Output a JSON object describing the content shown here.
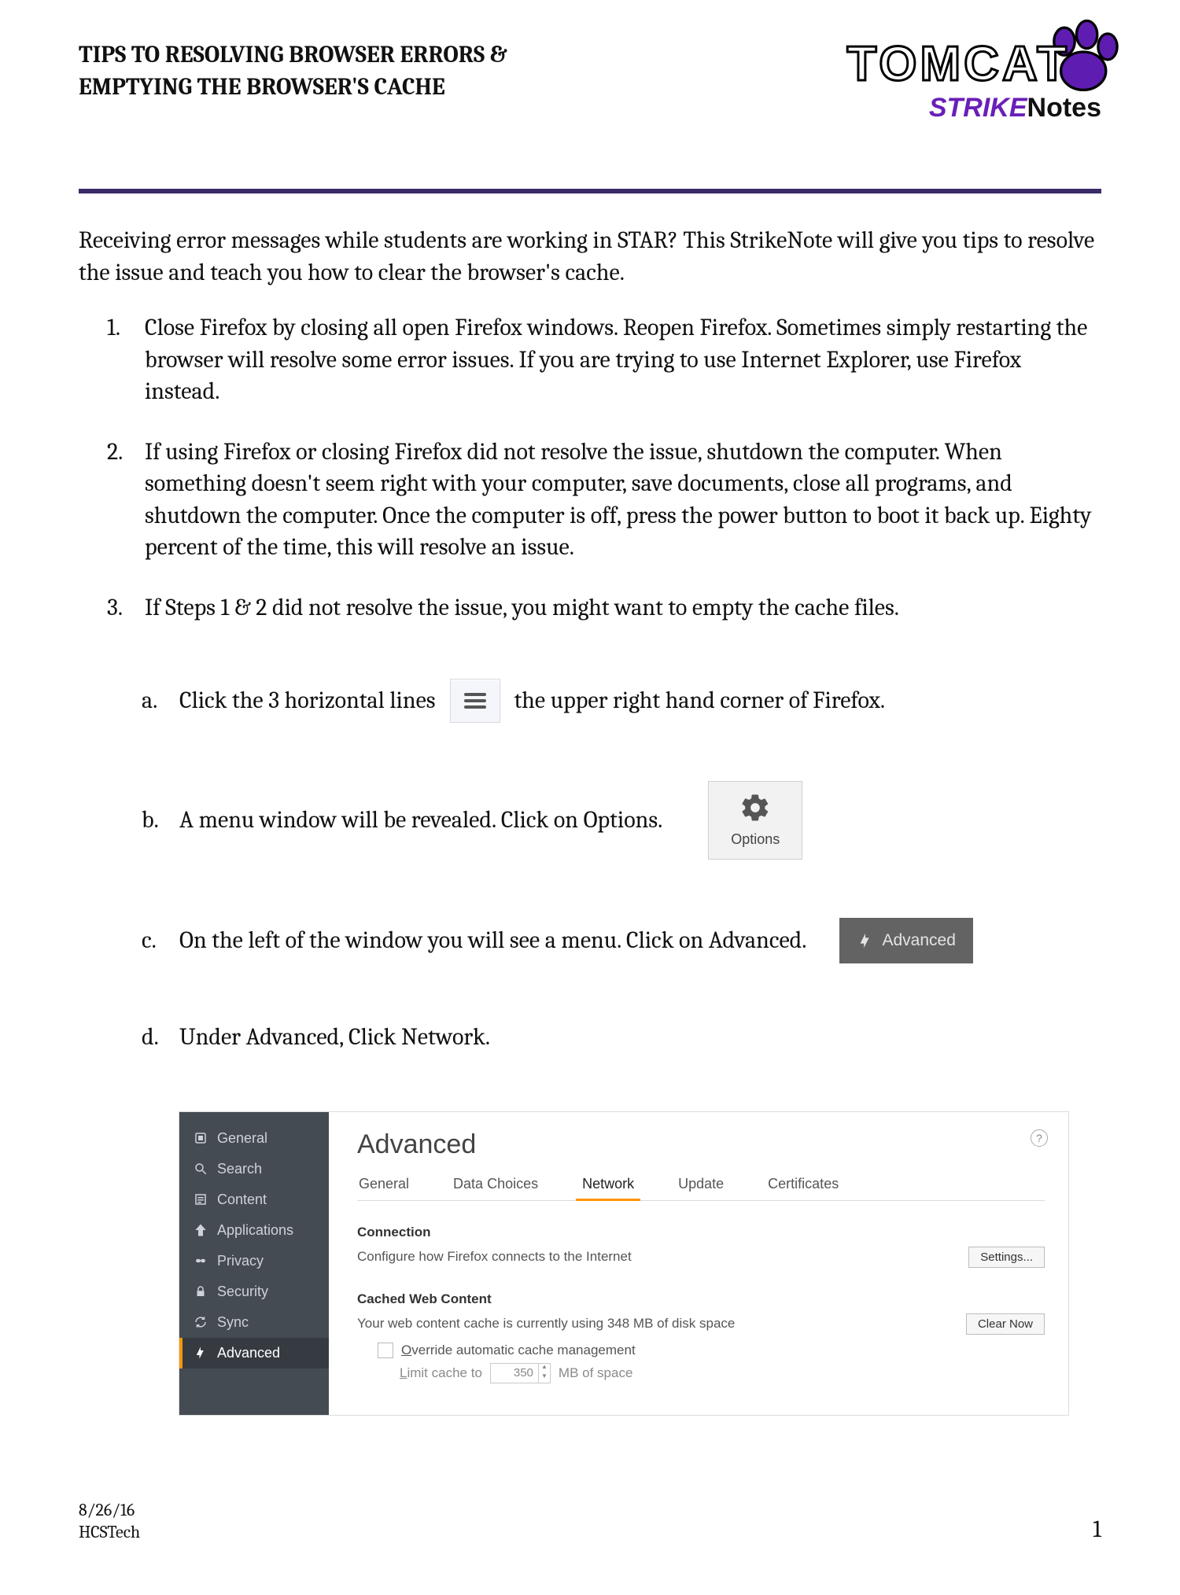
{
  "header": {
    "title_line1": "TIPS TO RESOLVING BROWSER ERRORS &",
    "title_line2": "EMPTYING THE BROWSER'S CACHE",
    "logo_word1": "TOMCAT",
    "logo_word2a": "STRIKE",
    "logo_word2b": "Notes"
  },
  "intro": "Receiving error messages while students are working in STAR?  This StrikeNote will give you tips to resolve the issue and teach you how to clear the browser's cache.",
  "steps": {
    "s1": "Close Firefox by closing all open Firefox windows. Reopen Firefox.  Sometimes simply restarting the browser will resolve some error issues.  If you are trying to use Internet Explorer, use Firefox instead.",
    "s2": "If using Firefox or closing Firefox did not resolve the issue, shutdown the computer.  When something doesn't seem right with your computer, save documents, close all programs, and shutdown the computer.  Once the computer is off, press the power button to boot it back up.  Eighty percent of the time, this will resolve an issue.",
    "s3": "If Steps 1 & 2 did not resolve the issue, you might want to empty the cache files."
  },
  "sub": {
    "a_pre": "Click the 3 horizontal lines",
    "a_post": "the upper right hand corner of Firefox.",
    "b": "A menu window will be revealed.  Click on Options.",
    "c": "On the left of the window you will see a menu.  Click on Advanced.",
    "d": "Under Advanced, Click Network."
  },
  "ui": {
    "options_label": "Options",
    "advanced_label": "Advanced"
  },
  "ff": {
    "title": "Advanced",
    "help": "?",
    "sidebar": {
      "general": "General",
      "search": "Search",
      "content": "Content",
      "applications": "Applications",
      "privacy": "Privacy",
      "security": "Security",
      "sync": "Sync",
      "advanced": "Advanced"
    },
    "tabs": {
      "general": "General",
      "data_choices": "Data Choices",
      "network": "Network",
      "update": "Update",
      "certificates": "Certificates"
    },
    "connection": {
      "heading": "Connection",
      "desc": "Configure how Firefox connects to the Internet",
      "settings_btn": "Settings..."
    },
    "cache": {
      "heading": "Cached Web Content",
      "desc": "Your web content cache is currently using 348 MB of disk space",
      "clear_btn": "Clear Now",
      "override_pre": "O",
      "override_post": "verride automatic cache management",
      "limit_pre": "L",
      "limit_post": "imit cache to",
      "limit_value": "350",
      "limit_unit": "MB of space"
    }
  },
  "footer": {
    "date": "8/26/16",
    "author": "HCSTech",
    "page": "1"
  }
}
